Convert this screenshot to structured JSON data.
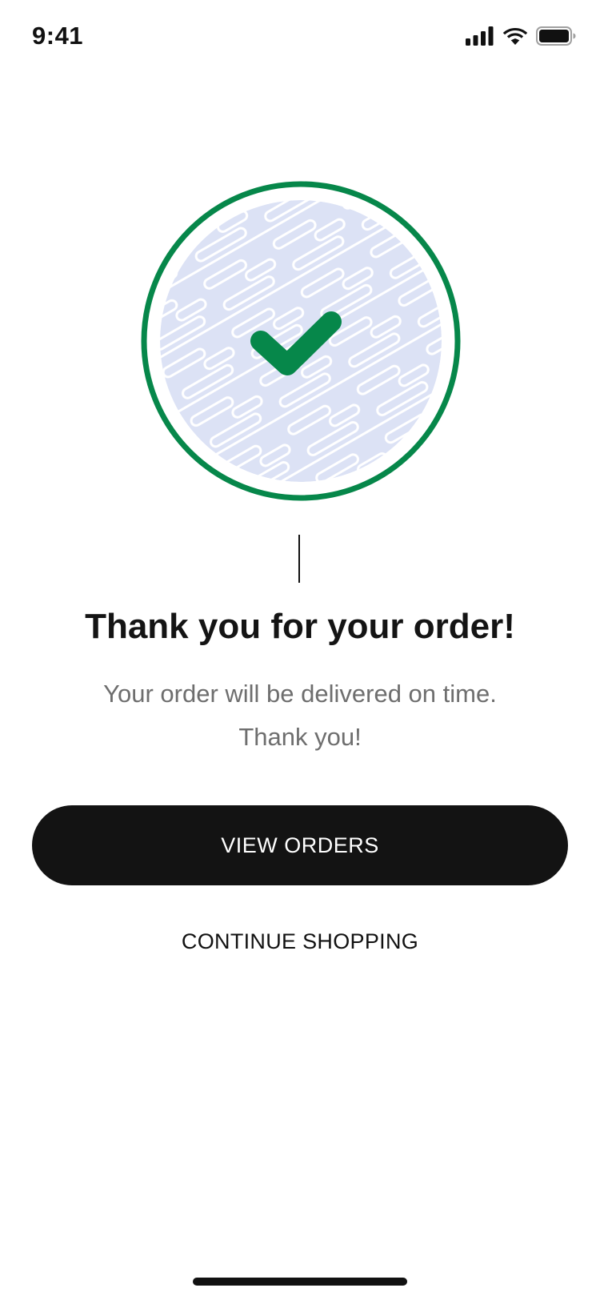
{
  "status_bar": {
    "time": "9:41",
    "icons": [
      "cellular-signal-icon",
      "wifi-icon",
      "battery-icon"
    ]
  },
  "illustration": {
    "icon": "checkmark-icon",
    "ring_color": "#06874a",
    "pattern_color": "#dce2f5",
    "check_color": "#06874a"
  },
  "confirmation": {
    "title": "Thank you for your order!",
    "message_line1": "Your order will be delivered on time.",
    "message_line2": "Thank you!"
  },
  "actions": {
    "view_orders_label": "VIEW ORDERS",
    "continue_shopping_label": "CONTINUE SHOPPING"
  },
  "colors": {
    "primary_button_bg": "#131313",
    "primary_button_text": "#ffffff",
    "title_text": "#141414",
    "message_text": "#6e6e6e"
  }
}
